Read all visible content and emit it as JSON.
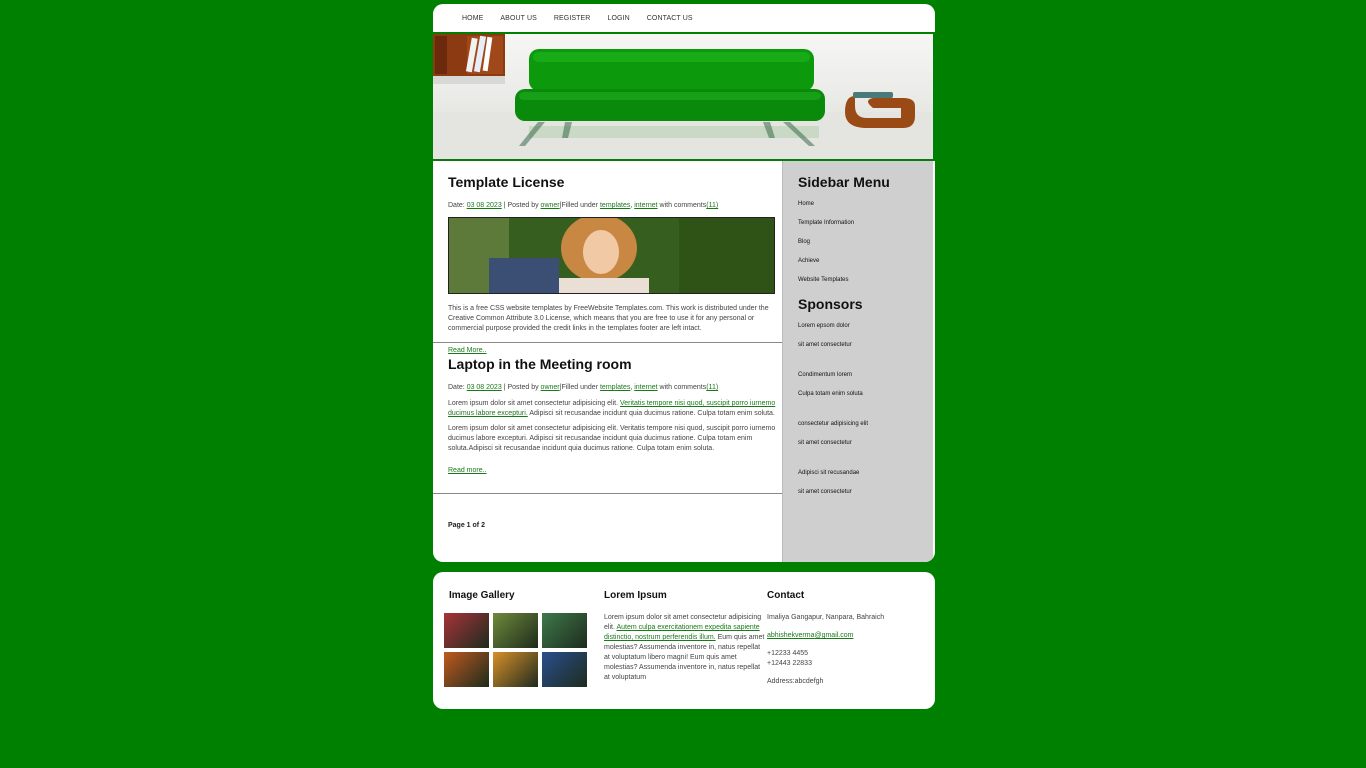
{
  "nav": {
    "items": [
      "HOME",
      "ABOUT US",
      "REGISTER",
      "LOGIN",
      "CONTACT US"
    ]
  },
  "posts": [
    {
      "title": "Template License",
      "date_label": "Date:",
      "date": "03 08 2023",
      "posted_by_label": "| Posted by",
      "author": "owner",
      "filed_label": "|Filled under",
      "tags": [
        "templates",
        "internet"
      ],
      "comments_label": "with comments",
      "comments": "(11)",
      "paragraphs": [
        "This is a free CSS website templates by FreeWebsite Templates.com. This work is distributed under the Creative Common Attribute 3.0 License, which means that you are free to use it for any personal or commercial purpose provided the credit links in the templates footer are left intact."
      ],
      "read_more": "Read More.."
    },
    {
      "title": "Laptop in the Meeting room",
      "date_label": "Date:",
      "date": "03 08 2023",
      "posted_by_label": "| Posted by",
      "author": "owner",
      "filed_label": "|Filled under",
      "tags": [
        "templates",
        "internet"
      ],
      "comments_label": "with comments",
      "comments": "(11)",
      "p1_a": "Lorem ipsum dolor sit amet consectetur adipisicing elit.",
      "p1_link": "Veritatis tempore nisi quod, suscipit porro iurnemo ducimus labore excepturi.",
      "p1_b": "Adipisci sit recusandae incidunt quia ducimus ratione. Culpa totam enim soluta.",
      "p2": "Lorem ipsum dolor sit amet consectetur adipisicing elit. Veritatis tempore nisi quod, suscipit porro iurnemo ducimus labore excepturi. Adipisci sit recusandae incidunt quia ducimus ratione. Culpa totam enim soluta.Adipisci sit recusandae incidunt quia ducimus ratione. Culpa totam enim soluta.",
      "read_more": "Read more.."
    }
  ],
  "pager": "Page 1 of 2",
  "sidebar": {
    "menu_title": "Sidebar Menu",
    "menu": [
      "Home",
      "Template Information",
      "Blog",
      "Achieve",
      "Website Templates"
    ],
    "sponsors_title": "Sponsors",
    "sponsors": [
      [
        "Lorem epsom dolor",
        "sit amet consectetur"
      ],
      [
        "Condimentum lorem",
        "Culpa totam enim soluta"
      ],
      [
        "consectetur adipisicing elit",
        "sit amet consectetur"
      ],
      [
        "Adipisci sit recusandae",
        "sit amet consectetur"
      ]
    ]
  },
  "footer": {
    "gallery_title": "Image Gallery",
    "gallery_colors": [
      "#a8333a",
      "#6f8a3b",
      "#3f7a4a",
      "#c05a1e",
      "#d8902a",
      "#2a4f8e"
    ],
    "lorem_title": "Lorem Ipsum",
    "lorem_a": "Lorem ipsum dolor sit amet consectetur adipisicing elit.",
    "lorem_link": "Autem culpa exercitationem expedita sapiente distinctio, nostrum perferendis illum.",
    "lorem_b": "Eum quis amet molestias? Assumenda inventore in, natus repellat at voluptatum libero magni! Eum quis amet molestias? Assumenda inventore in, natus repellat at voluptatum",
    "contact_title": "Contact",
    "address": "Imaliya Gangapur, Nanpara, Bahraich",
    "email": "abhishekverma@gmail.com",
    "phone1": "+12233 4455",
    "phone2": "+12443 22833",
    "address2": "Address:abcdefgh"
  }
}
